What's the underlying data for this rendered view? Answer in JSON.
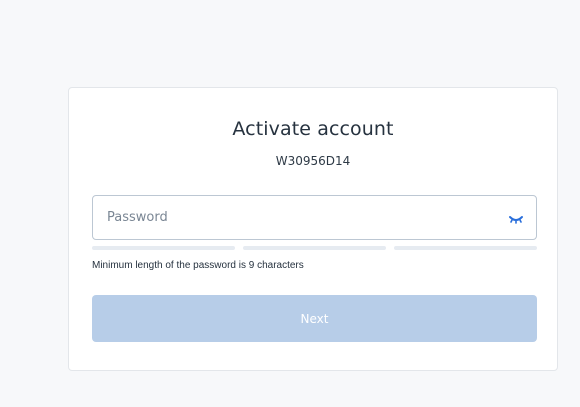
{
  "form": {
    "title": "Activate account",
    "account_id": "W30956D14",
    "password_placeholder": "Password",
    "password_value": "",
    "show_password_icon": "eye-closed-icon",
    "strength_segments_filled": 0,
    "strength_segments_total": 3,
    "hint": "Minimum length of the password is 9 characters",
    "next_label": "Next",
    "next_enabled": false
  },
  "colors": {
    "background": "#f7f8fa",
    "card": "#ffffff",
    "input_border": "#bcc7d3",
    "strength_empty": "#e6ebf1",
    "button_disabled": "#b7cde8",
    "icon_accent": "#2a6fdb"
  }
}
